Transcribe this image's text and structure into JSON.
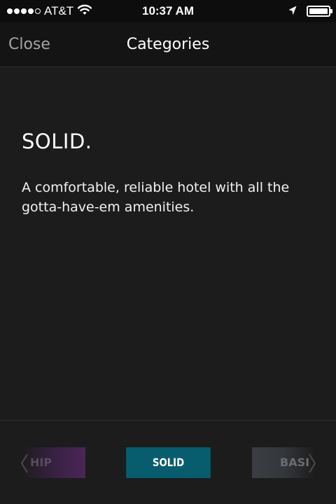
{
  "status_bar": {
    "carrier": "AT&T",
    "time": "10:37 AM",
    "signal_dots_filled": 4,
    "signal_dots_total": 5,
    "icons": [
      "wifi-icon",
      "location-arrow-icon",
      "battery-icon"
    ]
  },
  "nav": {
    "close_label": "Close",
    "title": "Categories"
  },
  "category": {
    "title": "SOLID.",
    "description": "A comfortable, reliable hotel with all the gotta-have-em amenities."
  },
  "selector": {
    "tabs": [
      {
        "label": "HIP",
        "selected": false,
        "color": "#4a2656"
      },
      {
        "label": "SOLID",
        "selected": true,
        "color": "#075d6d"
      },
      {
        "label": "BASI",
        "selected": false,
        "color": "#3a3d42"
      }
    ],
    "icons": [
      "chevron-left-icon",
      "chevron-right-icon"
    ]
  },
  "colors": {
    "background": "#1c1c1c",
    "nav_background": "#141414",
    "accent": "#075d6d"
  }
}
